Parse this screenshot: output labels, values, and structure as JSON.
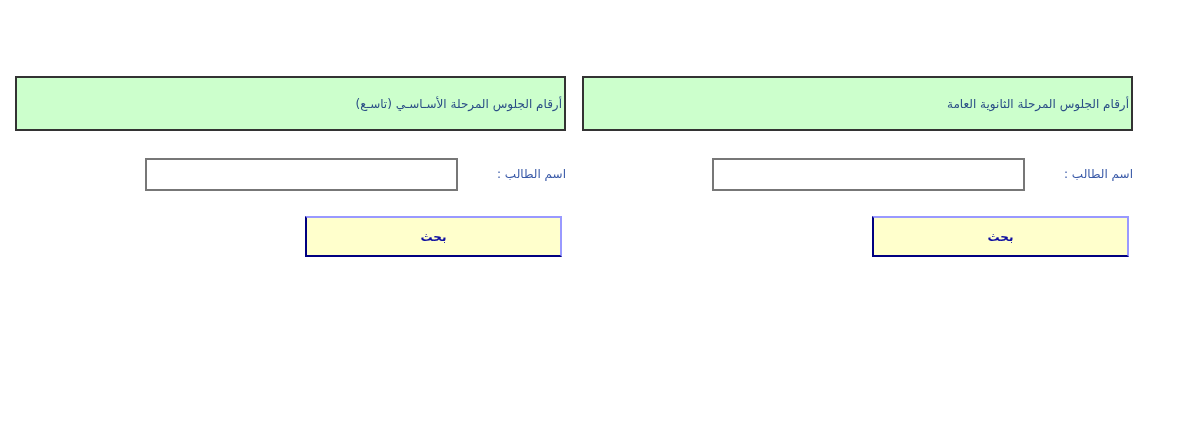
{
  "panels": [
    {
      "title": "أرقام الجلوس المرحلة الثانوية العامة",
      "field_label": "اسم الطالب :",
      "button": "بحث"
    },
    {
      "title": "أرقام الجلوس المرحلة الأسـاسـي (تاسـع)",
      "field_label": "اسم الطالب :",
      "button": "بحث"
    }
  ]
}
